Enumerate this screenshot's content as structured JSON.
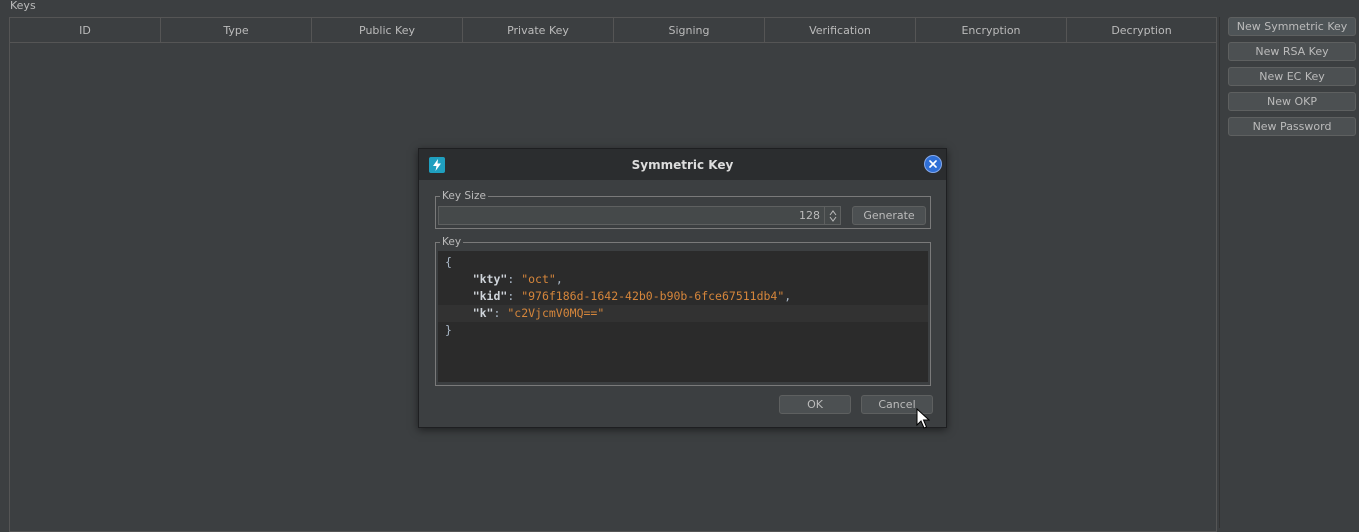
{
  "section_label": "Keys",
  "table": {
    "columns": [
      "ID",
      "Type",
      "Public Key",
      "Private Key",
      "Signing",
      "Verification",
      "Encryption",
      "Decryption"
    ]
  },
  "side_buttons": [
    "New Symmetric Key",
    "New RSA Key",
    "New EC Key",
    "New OKP",
    "New Password"
  ],
  "dialog": {
    "title": "Symmetric Key",
    "key_size_label": "Key Size",
    "key_size_value": "128",
    "generate_label": "Generate",
    "key_label": "Key",
    "key_json": {
      "open_brace": "{",
      "close_brace": "}",
      "entries": [
        {
          "name": "\"kty\"",
          "value": "\"oct\"",
          "trailing": ","
        },
        {
          "name": "\"kid\"",
          "value": "\"976f186d-1642-42b0-b90b-6fce67511db4\"",
          "trailing": ","
        },
        {
          "name": "\"k\"",
          "value": "\"c2VjcmV0MQ==\"",
          "trailing": ""
        }
      ]
    },
    "ok_label": "OK",
    "cancel_label": "Cancel"
  },
  "colors": {
    "background": "#3c3f41",
    "editor_background": "#2b2b2b",
    "string_value": "#d6863b",
    "close_button": "#2f6fd6",
    "app_icon": "#1f9fbf"
  },
  "icons": [
    "app-logo-icon",
    "close-icon",
    "spinner-up-icon",
    "spinner-down-icon",
    "mouse-pointer-icon"
  ]
}
